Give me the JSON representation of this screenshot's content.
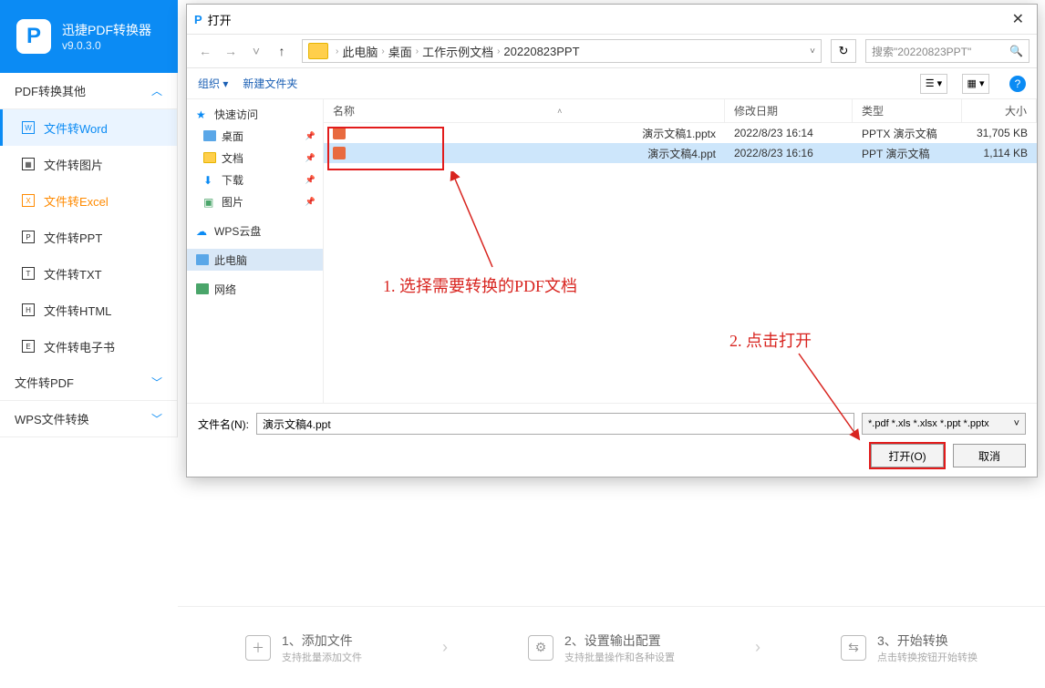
{
  "app": {
    "title": "迅捷PDF转换器",
    "version": "v9.0.3.0"
  },
  "sidebar": {
    "section1": "PDF转换其他",
    "items": [
      "文件转Word",
      "文件转图片",
      "文件转Excel",
      "文件转PPT",
      "文件转TXT",
      "文件转HTML",
      "文件转电子书"
    ],
    "section2": "文件转PDF",
    "section3": "WPS文件转换"
  },
  "steps": {
    "s1t": "1、添加文件",
    "s1d": "支持批量添加文件",
    "s2t": "2、设置输出配置",
    "s2d": "支持批量操作和各种设置",
    "s3t": "3、开始转换",
    "s3d": "点击转换按钮开始转换"
  },
  "dialog": {
    "title": "打开",
    "breadcrumbs": [
      "此电脑",
      "桌面",
      "工作示例文档",
      "20220823PPT"
    ],
    "search_placeholder": "搜索\"20220823PPT\"",
    "organize": "组织",
    "newfolder": "新建文件夹",
    "tree": {
      "quick": "快速访问",
      "desktop": "桌面",
      "docs": "文档",
      "downloads": "下载",
      "pictures": "图片",
      "wpscloud": "WPS云盘",
      "thispc": "此电脑",
      "network": "网络"
    },
    "columns": {
      "name": "名称",
      "date": "修改日期",
      "type": "类型",
      "size": "大小"
    },
    "rows": [
      {
        "name": "演示文稿1.pptx",
        "date": "2022/8/23 16:14",
        "type": "PPTX 演示文稿",
        "size": "31,705 KB"
      },
      {
        "name": "演示文稿4.ppt",
        "date": "2022/8/23 16:16",
        "type": "PPT 演示文稿",
        "size": "1,114 KB"
      }
    ],
    "filename_label": "文件名(N):",
    "filename_value": "演示文稿4.ppt",
    "filter": "*.pdf *.xls *.xlsx *.ppt *.pptx",
    "open_btn": "打开(O)",
    "cancel_btn": "取消"
  },
  "annotations": {
    "a1": "1. 选择需要转换的PDF文档",
    "a2": "2. 点击打开"
  }
}
